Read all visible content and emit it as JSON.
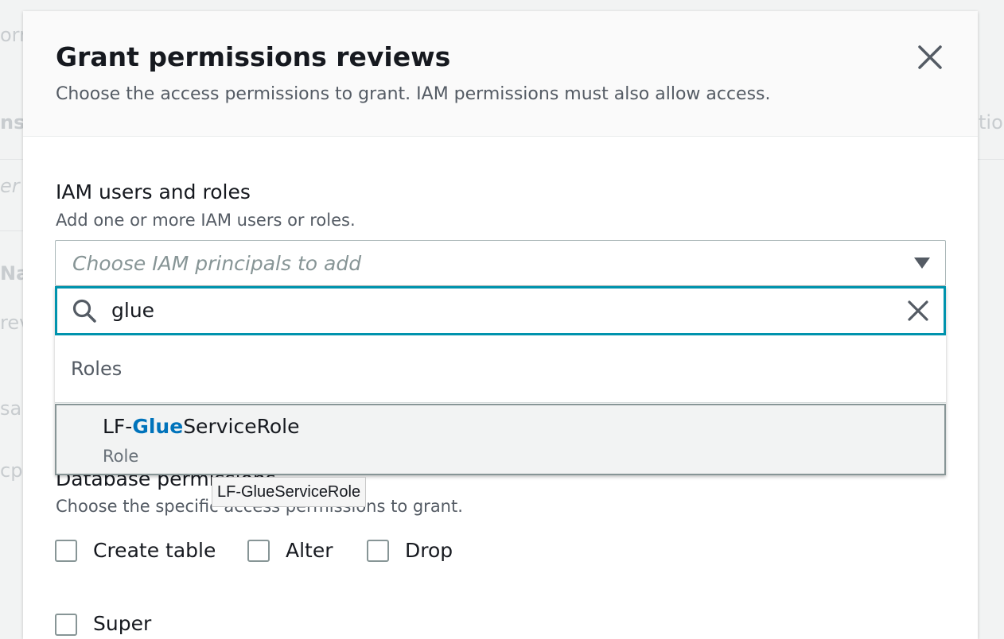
{
  "background": {
    "fragments": [
      "orm",
      "nso",
      "tio",
      "er",
      "Na",
      "rev",
      "sam",
      "cpc"
    ]
  },
  "modal": {
    "title": "Grant permissions reviews",
    "description": "Choose the access permissions to grant. IAM permissions must also allow access."
  },
  "iam": {
    "label": "IAM users and roles",
    "description": "Add one or more IAM users or roles.",
    "placeholder": "Choose IAM principals to add",
    "search_value": "glue",
    "group_label": "Roles",
    "option": {
      "prefix": "LF-",
      "match": "Glue",
      "suffix": "ServiceRole",
      "sub": "Role"
    }
  },
  "tooltip": "LF-GlueServiceRole",
  "database_permissions": {
    "label": "Database permissions",
    "description": "Choose the specific access permissions to grant.",
    "options": [
      "Create table",
      "Alter",
      "Drop",
      "Super"
    ]
  },
  "colors": {
    "accent": "#0093ad",
    "match_highlight": "#0073bb"
  }
}
